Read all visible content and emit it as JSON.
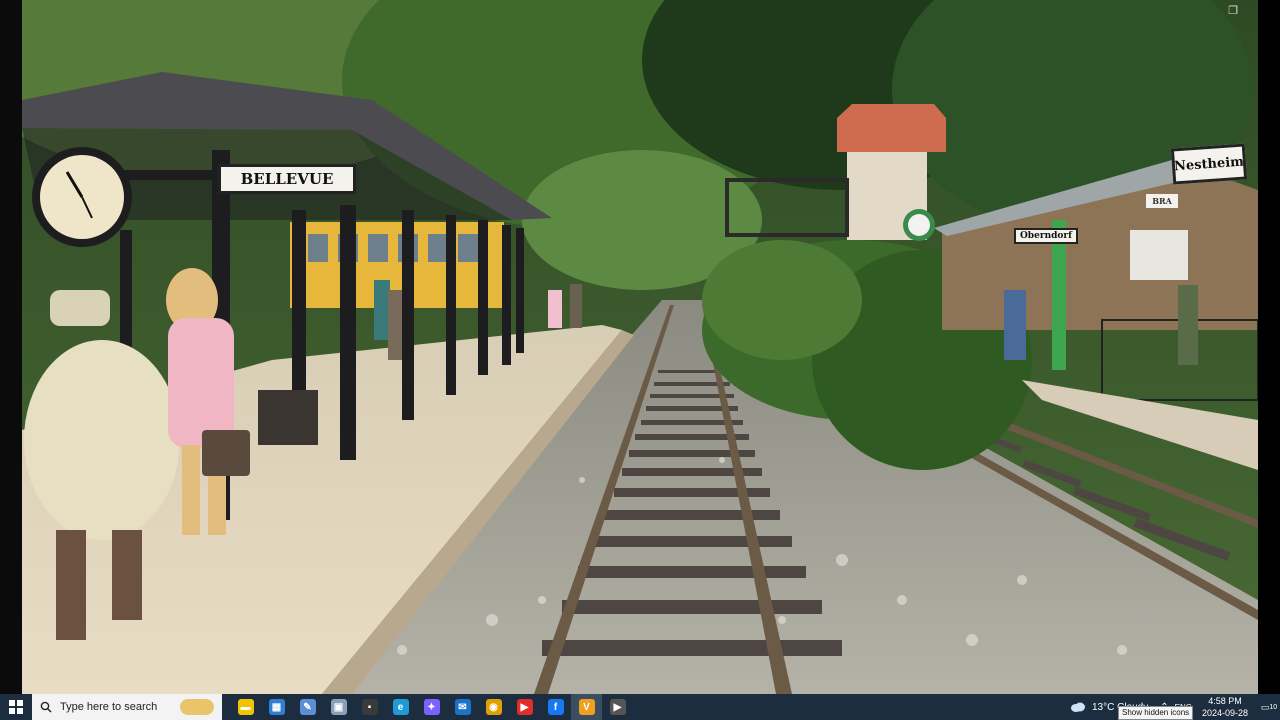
{
  "signs": {
    "bellevue": "BELLEVUE",
    "nestheim": "Nestheim",
    "oberndorf": "Oberndorf",
    "bra": "BRA"
  },
  "taskbar": {
    "search_placeholder": "Type here to search",
    "pinned_apps": [
      {
        "name": "file-explorer",
        "color": "#f2c200",
        "glyph": "▬"
      },
      {
        "name": "store",
        "color": "#2f7fd4",
        "glyph": "▦"
      },
      {
        "name": "notes",
        "color": "#5a8fd8",
        "glyph": "✎"
      },
      {
        "name": "task-view",
        "color": "#8aa0b8",
        "glyph": "▣"
      },
      {
        "name": "media",
        "color": "#3a3a3a",
        "glyph": "▪"
      },
      {
        "name": "edge",
        "color": "#1f9ad6",
        "glyph": "e"
      },
      {
        "name": "copilot",
        "color": "#7b61ff",
        "glyph": "✦"
      },
      {
        "name": "mail",
        "color": "#1a73c9",
        "glyph": "✉"
      },
      {
        "name": "chrome",
        "color": "#e0a000",
        "glyph": "◉"
      },
      {
        "name": "youtube",
        "color": "#e52d27",
        "glyph": "▶"
      },
      {
        "name": "facebook",
        "color": "#1877f2",
        "glyph": "f"
      },
      {
        "name": "vegas",
        "color": "#f0a020",
        "glyph": "V"
      },
      {
        "name": "player",
        "color": "#555555",
        "glyph": "▶"
      }
    ],
    "weather": "13°C  Cloudy",
    "time": "4:58 PM",
    "date": "2024-09-28",
    "notifications": "10",
    "tooltip": "Show hidden icons",
    "lang": "ENG"
  },
  "colors": {
    "taskbar_bg": "#1c2d3f",
    "accent": "#2f7fd4"
  }
}
